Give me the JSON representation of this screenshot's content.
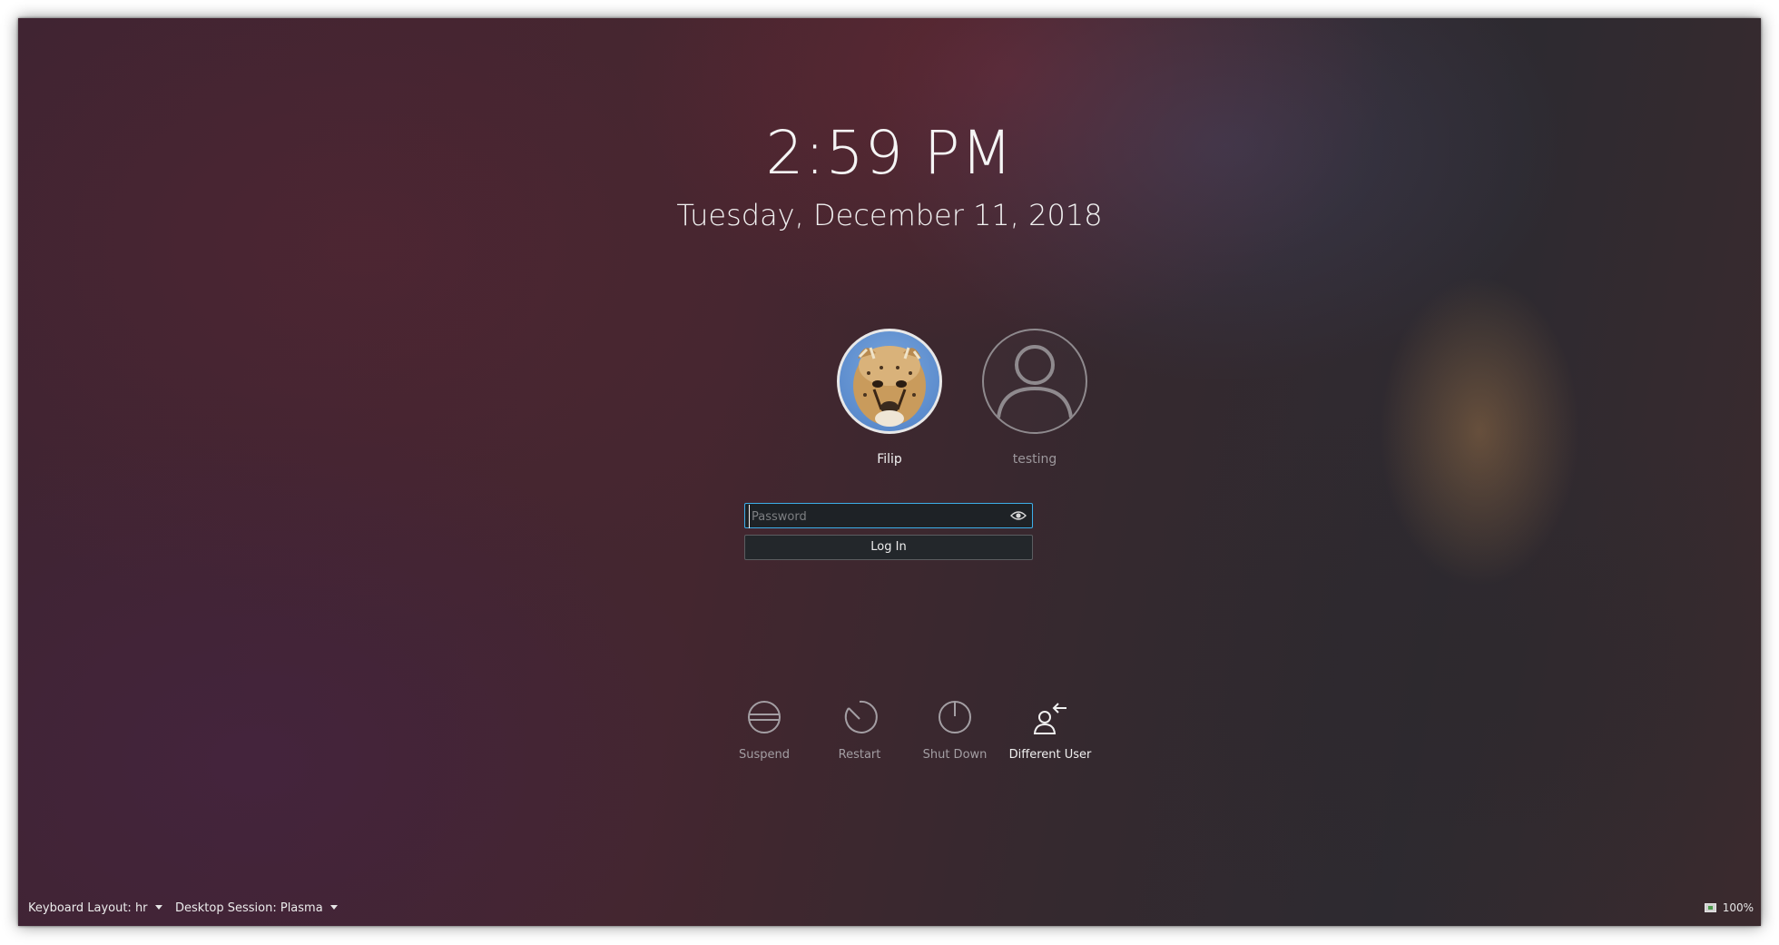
{
  "clock": {
    "time": "2:59 PM",
    "date": "Tuesday, December 11, 2018"
  },
  "users": [
    {
      "name": "Filip",
      "avatar_icon": "cheetah-avatar",
      "selected": true
    },
    {
      "name": "testing",
      "avatar_icon": "user-icon",
      "selected": false
    }
  ],
  "login": {
    "password_placeholder": "Password",
    "login_label": "Log In",
    "reveal_icon": "eye-icon"
  },
  "actions": [
    {
      "label": "Suspend",
      "icon": "suspend-icon"
    },
    {
      "label": "Restart",
      "icon": "restart-icon"
    },
    {
      "label": "Shut Down",
      "icon": "shutdown-icon"
    },
    {
      "label": "Different User",
      "icon": "switch-user-icon"
    }
  ],
  "bottom_bar": {
    "keyboard_layout": "Keyboard Layout: hr",
    "desktop_session": "Desktop Session: Plasma",
    "battery": "100%"
  },
  "colors": {
    "accent": "#3daee9"
  }
}
